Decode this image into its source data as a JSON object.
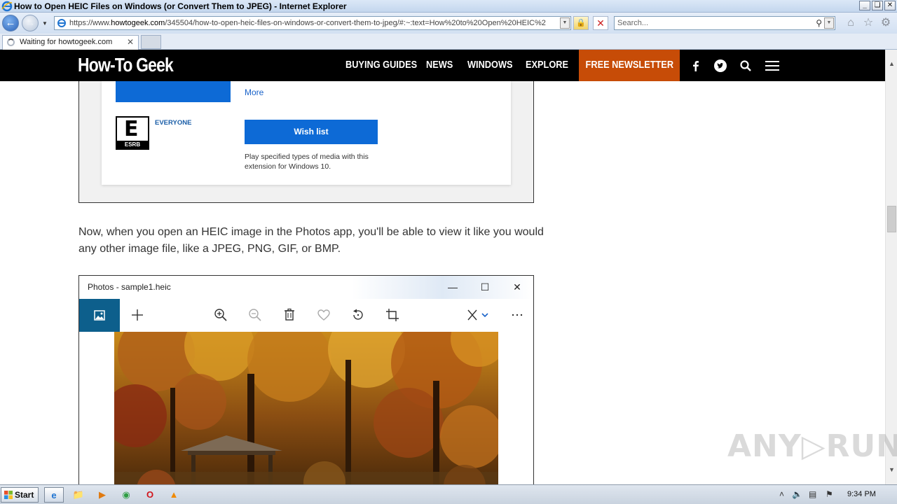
{
  "window": {
    "title": "How to Open HEIC Files on Windows (or Convert Them to JPEG) - Internet Explorer"
  },
  "address_bar": {
    "url_prefix": "https://www.",
    "url_domain": "howtogeek.com",
    "url_path": "/345504/how-to-open-heic-files-on-windows-or-convert-them-to-jpeg/#:~:text=How%20to%20Open%20HEIC%2"
  },
  "search_bar": {
    "placeholder": "Search..."
  },
  "tab": {
    "label": "Waiting for howtogeek.com"
  },
  "site": {
    "logo": "How-To Geek",
    "nav": [
      "BUYING GUIDES",
      "NEWS",
      "WINDOWS",
      "EXPLORE"
    ],
    "newsletter": "FREE NEWSLETTER"
  },
  "store_figure": {
    "more": "More",
    "rating": "EVERYONE",
    "esrb_letter": "E",
    "esrb_label": "ESRB",
    "wishlist": "Wish list",
    "description": "Play specified types of media with this extension for Windows 10."
  },
  "article": {
    "paragraph": "Now, when you open an HEIC image in the Photos app, you'll be able to view it like you would any other image file, like a JPEG, PNG, GIF, or BMP."
  },
  "photos_figure": {
    "title": "Photos - sample1.heic"
  },
  "watermark": "ANY▷RUN",
  "taskbar": {
    "start": "Start",
    "clock": "9:34 PM"
  },
  "colors": {
    "site_header": "#000000",
    "newsletter": "#c74c07",
    "store_blue": "#0d6ad6",
    "photos_accent": "#0d5f8c"
  }
}
